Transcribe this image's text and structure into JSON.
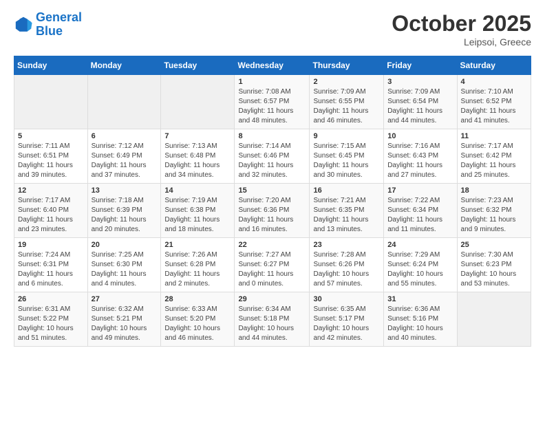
{
  "logo": {
    "line1": "General",
    "line2": "Blue"
  },
  "title": "October 2025",
  "subtitle": "Leipsoi, Greece",
  "days_header": [
    "Sunday",
    "Monday",
    "Tuesday",
    "Wednesday",
    "Thursday",
    "Friday",
    "Saturday"
  ],
  "weeks": [
    [
      {
        "day": "",
        "info": ""
      },
      {
        "day": "",
        "info": ""
      },
      {
        "day": "",
        "info": ""
      },
      {
        "day": "1",
        "info": "Sunrise: 7:08 AM\nSunset: 6:57 PM\nDaylight: 11 hours and 48 minutes."
      },
      {
        "day": "2",
        "info": "Sunrise: 7:09 AM\nSunset: 6:55 PM\nDaylight: 11 hours and 46 minutes."
      },
      {
        "day": "3",
        "info": "Sunrise: 7:09 AM\nSunset: 6:54 PM\nDaylight: 11 hours and 44 minutes."
      },
      {
        "day": "4",
        "info": "Sunrise: 7:10 AM\nSunset: 6:52 PM\nDaylight: 11 hours and 41 minutes."
      }
    ],
    [
      {
        "day": "5",
        "info": "Sunrise: 7:11 AM\nSunset: 6:51 PM\nDaylight: 11 hours and 39 minutes."
      },
      {
        "day": "6",
        "info": "Sunrise: 7:12 AM\nSunset: 6:49 PM\nDaylight: 11 hours and 37 minutes."
      },
      {
        "day": "7",
        "info": "Sunrise: 7:13 AM\nSunset: 6:48 PM\nDaylight: 11 hours and 34 minutes."
      },
      {
        "day": "8",
        "info": "Sunrise: 7:14 AM\nSunset: 6:46 PM\nDaylight: 11 hours and 32 minutes."
      },
      {
        "day": "9",
        "info": "Sunrise: 7:15 AM\nSunset: 6:45 PM\nDaylight: 11 hours and 30 minutes."
      },
      {
        "day": "10",
        "info": "Sunrise: 7:16 AM\nSunset: 6:43 PM\nDaylight: 11 hours and 27 minutes."
      },
      {
        "day": "11",
        "info": "Sunrise: 7:17 AM\nSunset: 6:42 PM\nDaylight: 11 hours and 25 minutes."
      }
    ],
    [
      {
        "day": "12",
        "info": "Sunrise: 7:17 AM\nSunset: 6:40 PM\nDaylight: 11 hours and 23 minutes."
      },
      {
        "day": "13",
        "info": "Sunrise: 7:18 AM\nSunset: 6:39 PM\nDaylight: 11 hours and 20 minutes."
      },
      {
        "day": "14",
        "info": "Sunrise: 7:19 AM\nSunset: 6:38 PM\nDaylight: 11 hours and 18 minutes."
      },
      {
        "day": "15",
        "info": "Sunrise: 7:20 AM\nSunset: 6:36 PM\nDaylight: 11 hours and 16 minutes."
      },
      {
        "day": "16",
        "info": "Sunrise: 7:21 AM\nSunset: 6:35 PM\nDaylight: 11 hours and 13 minutes."
      },
      {
        "day": "17",
        "info": "Sunrise: 7:22 AM\nSunset: 6:34 PM\nDaylight: 11 hours and 11 minutes."
      },
      {
        "day": "18",
        "info": "Sunrise: 7:23 AM\nSunset: 6:32 PM\nDaylight: 11 hours and 9 minutes."
      }
    ],
    [
      {
        "day": "19",
        "info": "Sunrise: 7:24 AM\nSunset: 6:31 PM\nDaylight: 11 hours and 6 minutes."
      },
      {
        "day": "20",
        "info": "Sunrise: 7:25 AM\nSunset: 6:30 PM\nDaylight: 11 hours and 4 minutes."
      },
      {
        "day": "21",
        "info": "Sunrise: 7:26 AM\nSunset: 6:28 PM\nDaylight: 11 hours and 2 minutes."
      },
      {
        "day": "22",
        "info": "Sunrise: 7:27 AM\nSunset: 6:27 PM\nDaylight: 11 hours and 0 minutes."
      },
      {
        "day": "23",
        "info": "Sunrise: 7:28 AM\nSunset: 6:26 PM\nDaylight: 10 hours and 57 minutes."
      },
      {
        "day": "24",
        "info": "Sunrise: 7:29 AM\nSunset: 6:24 PM\nDaylight: 10 hours and 55 minutes."
      },
      {
        "day": "25",
        "info": "Sunrise: 7:30 AM\nSunset: 6:23 PM\nDaylight: 10 hours and 53 minutes."
      }
    ],
    [
      {
        "day": "26",
        "info": "Sunrise: 6:31 AM\nSunset: 5:22 PM\nDaylight: 10 hours and 51 minutes."
      },
      {
        "day": "27",
        "info": "Sunrise: 6:32 AM\nSunset: 5:21 PM\nDaylight: 10 hours and 49 minutes."
      },
      {
        "day": "28",
        "info": "Sunrise: 6:33 AM\nSunset: 5:20 PM\nDaylight: 10 hours and 46 minutes."
      },
      {
        "day": "29",
        "info": "Sunrise: 6:34 AM\nSunset: 5:18 PM\nDaylight: 10 hours and 44 minutes."
      },
      {
        "day": "30",
        "info": "Sunrise: 6:35 AM\nSunset: 5:17 PM\nDaylight: 10 hours and 42 minutes."
      },
      {
        "day": "31",
        "info": "Sunrise: 6:36 AM\nSunset: 5:16 PM\nDaylight: 10 hours and 40 minutes."
      },
      {
        "day": "",
        "info": ""
      }
    ]
  ]
}
